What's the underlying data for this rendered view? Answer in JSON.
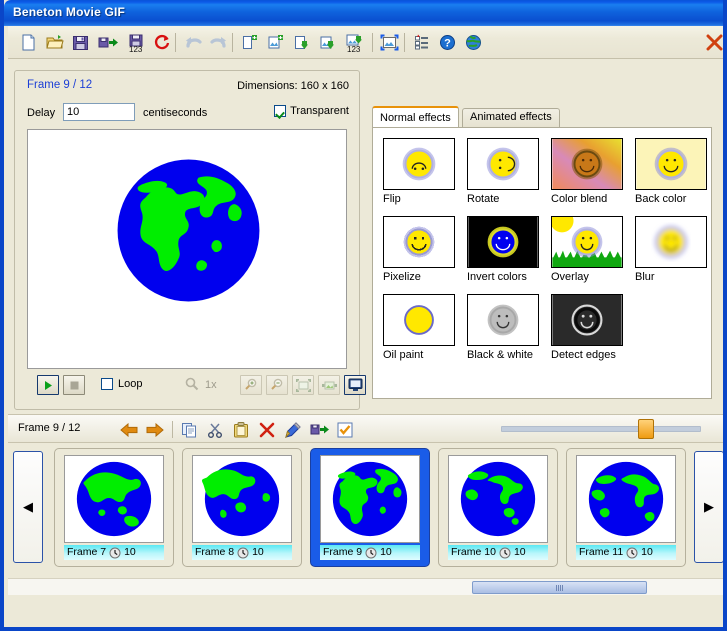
{
  "window": {
    "title": "Beneton Movie GIF"
  },
  "toolbar": {
    "items": [
      {
        "name": "new-file-button",
        "label": "New",
        "icon": "page-icon"
      },
      {
        "name": "open-file-button",
        "label": "Open",
        "icon": "folder-open-icon"
      },
      {
        "name": "save-button",
        "label": "Save",
        "icon": "floppy-disk-icon"
      },
      {
        "name": "save-as-button",
        "label": "Save as",
        "icon": "floppy-arrow-icon"
      },
      {
        "name": "save-frames-button",
        "label": "Save frames",
        "icon": "floppy-123-icon"
      },
      {
        "name": "reload-button",
        "label": "Reload",
        "icon": "refresh-icon"
      },
      {
        "name": "undo-button",
        "label": "Undo",
        "icon": "undo-arrow-icon"
      },
      {
        "name": "redo-button",
        "label": "Redo",
        "icon": "redo-arrow-icon"
      },
      {
        "name": "new-frame-button",
        "label": "New frame",
        "icon": "page-plus-icon"
      },
      {
        "name": "insert-image-button",
        "label": "Insert image",
        "icon": "image-plus-icon"
      },
      {
        "name": "import-frame-button",
        "label": "Import frame",
        "icon": "page-down-icon"
      },
      {
        "name": "import-image-button",
        "label": "Import image",
        "icon": "image-down-icon"
      },
      {
        "name": "import-frames-button",
        "label": "Import frames",
        "icon": "image-123-icon"
      },
      {
        "name": "resize-button",
        "label": "Resize",
        "icon": "resize-icon"
      },
      {
        "name": "properties-button",
        "label": "Properties",
        "icon": "list-properties-icon"
      },
      {
        "name": "help-button",
        "label": "Help",
        "icon": "question-circle-icon"
      },
      {
        "name": "web-button",
        "label": "Web",
        "icon": "globe-icon"
      },
      {
        "name": "close-button",
        "label": "Close",
        "icon": "red-x-icon"
      }
    ]
  },
  "left_panel": {
    "frame_label": "Frame 9 / 12",
    "dimensions": "Dimensions: 160 x 160",
    "delay_label": "Delay",
    "delay_value": "10",
    "delay_units": "centiseconds",
    "transparent_label": "Transparent",
    "transparent_checked": true,
    "player": {
      "play_label": "Play",
      "stop_label": "Stop",
      "loop_label": "Loop",
      "loop_checked": false,
      "zoom_value": "1x",
      "buttons": [
        {
          "name": "zoom-in-button",
          "icon": "magnifier-plus-icon"
        },
        {
          "name": "zoom-out-button",
          "icon": "magnifier-minus-icon"
        },
        {
          "name": "fit-window-button",
          "icon": "fit-icon"
        },
        {
          "name": "actual-size-button",
          "icon": "actual-size-icon"
        },
        {
          "name": "fullscreen-preview-button",
          "icon": "monitor-icon"
        }
      ]
    }
  },
  "effects_panel": {
    "tabs": [
      {
        "label": "Normal effects",
        "active": true
      },
      {
        "label": "Animated effects",
        "active": false
      }
    ],
    "effects": [
      {
        "label": "Flip",
        "icon": "smiley-flipped-icon"
      },
      {
        "label": "Rotate",
        "icon": "smiley-rotated-icon"
      },
      {
        "label": "Color blend",
        "icon": "smiley-gradient-icon"
      },
      {
        "label": "Back color",
        "icon": "smiley-backcolor-icon"
      },
      {
        "label": "Pixelize",
        "icon": "smiley-pixelize-icon"
      },
      {
        "label": "Invert colors",
        "icon": "smiley-inverted-icon"
      },
      {
        "label": "Overlay",
        "icon": "smiley-overlay-icon"
      },
      {
        "label": "Blur",
        "icon": "smiley-blur-icon"
      },
      {
        "label": "Oil paint",
        "icon": "smiley-oilpaint-icon"
      },
      {
        "label": "Black & white",
        "icon": "smiley-grayscale-icon"
      },
      {
        "label": "Detect edges",
        "icon": "smiley-edges-icon"
      }
    ]
  },
  "frames_toolbar": {
    "frame_label": "Frame 9 / 12",
    "buttons": [
      {
        "name": "previous-frame-button",
        "icon": "arrow-left-icon"
      },
      {
        "name": "next-frame-button",
        "icon": "arrow-right-icon"
      },
      {
        "name": "copy-frame-button",
        "icon": "copy-icon"
      },
      {
        "name": "cut-frame-button",
        "icon": "scissors-icon"
      },
      {
        "name": "paste-frame-button",
        "icon": "clipboard-icon"
      },
      {
        "name": "delete-frame-button",
        "icon": "red-x-icon"
      },
      {
        "name": "edit-frame-button",
        "icon": "pencil-icon"
      },
      {
        "name": "export-frame-button",
        "icon": "floppy-arrow-icon"
      },
      {
        "name": "select-frame-button",
        "icon": "checkbox-checked-icon"
      }
    ],
    "slider_value": 68
  },
  "filmstrip": {
    "prev_label": "◀",
    "next_label": "▶",
    "frames": [
      {
        "label": "Frame 7",
        "delay": "10",
        "selected": false,
        "view": "asia"
      },
      {
        "label": "Frame 8",
        "delay": "10",
        "selected": false,
        "view": "indian"
      },
      {
        "label": "Frame 9",
        "delay": "10",
        "selected": true,
        "view": "africa"
      },
      {
        "label": "Frame 10",
        "delay": "10",
        "selected": false,
        "view": "atlantic"
      },
      {
        "label": "Frame 11",
        "delay": "10",
        "selected": false,
        "view": "americas"
      }
    ]
  },
  "colors": {
    "titlebar_blue": "#0a54d8",
    "window_border": "#0a46c8",
    "panel_bg": "#ece9d8",
    "globe_ocean": "#0000ee",
    "globe_land": "#00ee00",
    "accent_orange": "#e8920a",
    "selection_blue": "#1a5ce8",
    "caption_cyan": "#5ae8f2",
    "link_blue": "#1c3fd6"
  }
}
